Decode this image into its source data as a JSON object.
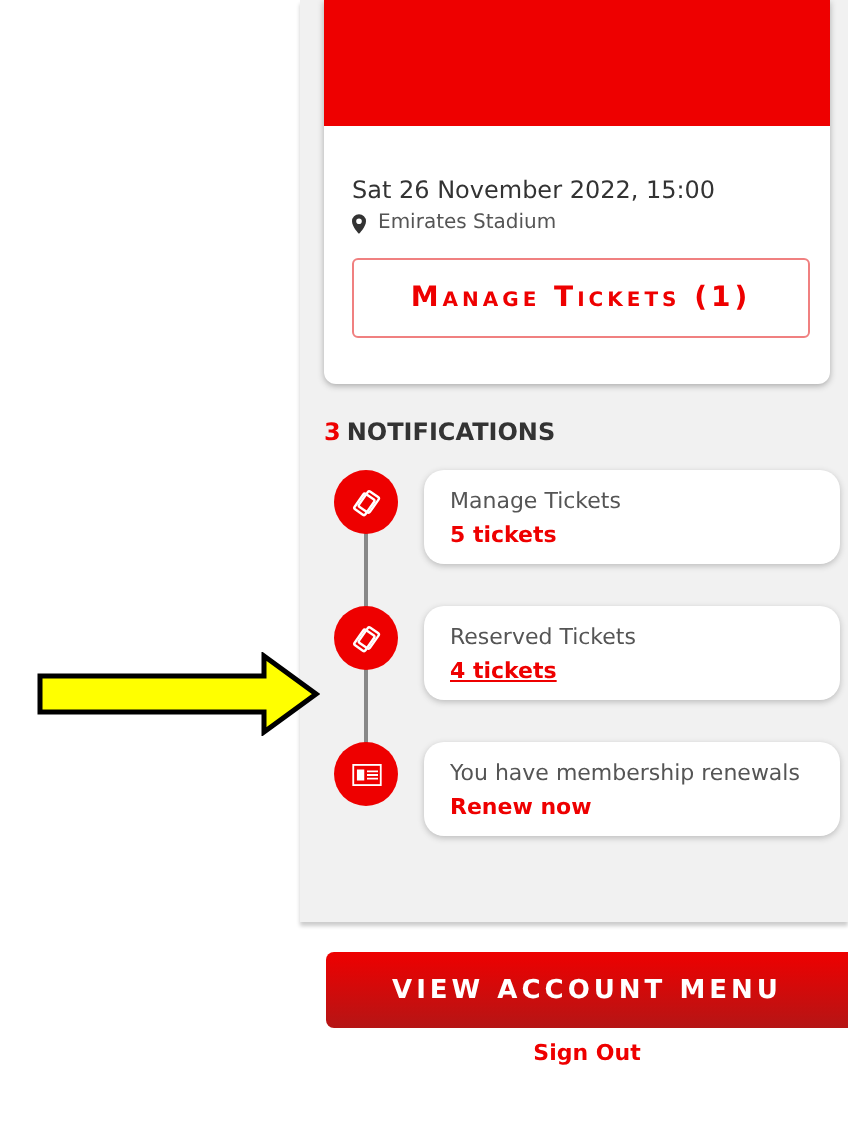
{
  "fixture": {
    "date": "Sat 26 November 2022, 15:00",
    "venue": "Emirates Stadium",
    "button": "Manage Tickets (1)"
  },
  "notifications": {
    "count": "3",
    "label": "NOTIFICATIONS",
    "items": [
      {
        "kind": "tickets",
        "title": "Manage Tickets",
        "link": "5 tickets",
        "underlined": false
      },
      {
        "kind": "tickets",
        "title": "Reserved Tickets",
        "link": "4 tickets",
        "underlined": true
      },
      {
        "kind": "membership",
        "title": "You have membership renewals",
        "link": "Renew now",
        "underlined": false
      }
    ]
  },
  "account_button": "VIEW ACCOUNT MENU",
  "sign_out": "Sign Out"
}
